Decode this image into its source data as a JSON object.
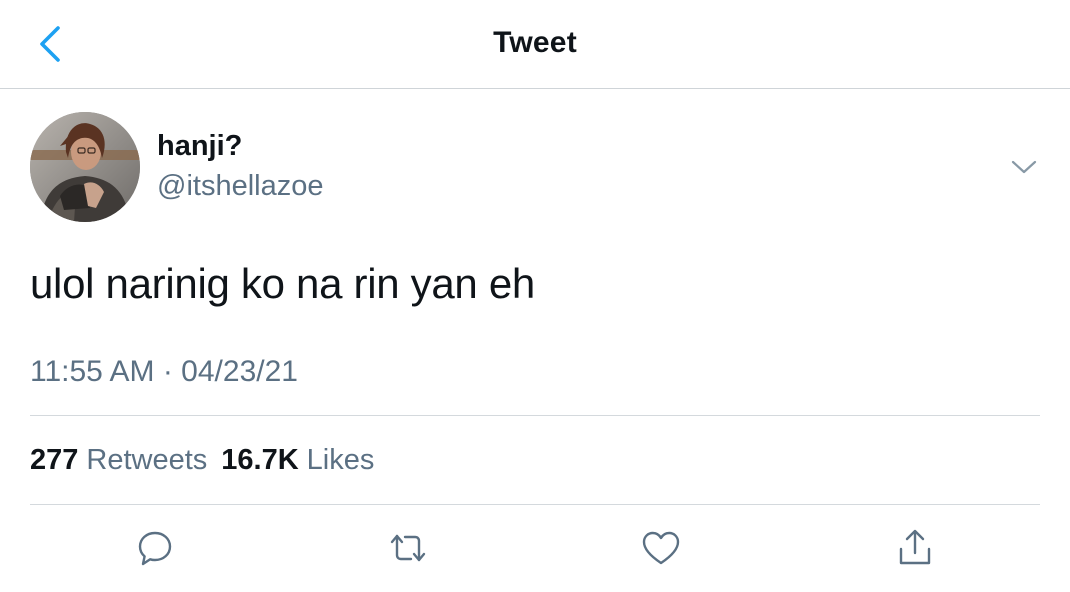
{
  "header": {
    "title": "Tweet",
    "back_icon": "chevron-left-icon",
    "accent_color": "#1da1f2"
  },
  "tweet": {
    "author": {
      "display_name": "hanji?",
      "handle": "@itshellazoe"
    },
    "text": "ulol narinig ko na rin yan eh",
    "timestamp": "11:55 AM · 04/23/21",
    "stats": {
      "retweets_count": "277",
      "retweets_label": "Retweets",
      "likes_count": "16.7K",
      "likes_label": "Likes"
    }
  },
  "actions": [
    {
      "icon": "reply-icon"
    },
    {
      "icon": "retweet-icon"
    },
    {
      "icon": "like-icon"
    },
    {
      "icon": "share-icon"
    }
  ],
  "colors": {
    "text_primary": "#0f1419",
    "text_secondary": "#5b7083",
    "divider": "#d4d9dd",
    "icon": "#5b7083"
  }
}
